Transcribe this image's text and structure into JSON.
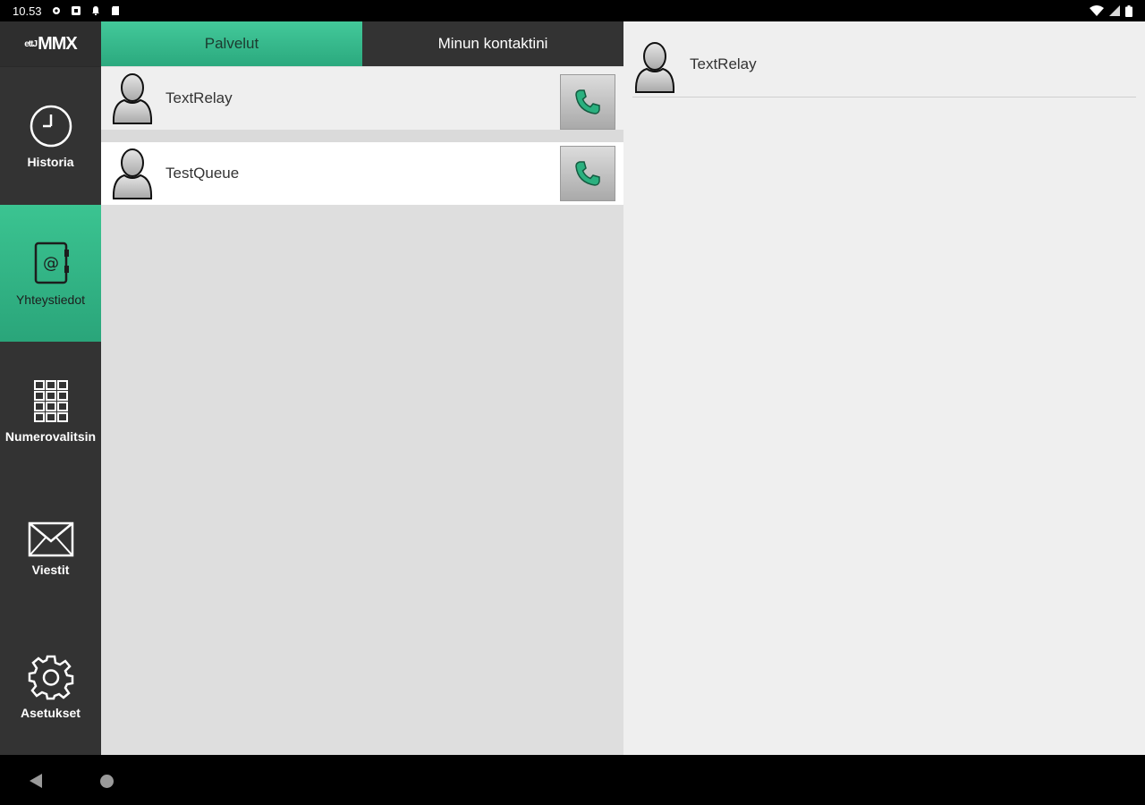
{
  "statusbar": {
    "time": "10.53"
  },
  "app": {
    "logo_prefix": "ettJ",
    "logo_main": "MMX"
  },
  "sidebar": {
    "items": [
      {
        "label": "Historia",
        "icon": "clock-icon",
        "active": false
      },
      {
        "label": "Yhteystiedot",
        "icon": "address-book-icon",
        "active": true
      },
      {
        "label": "Numerovalitsin",
        "icon": "dialpad-icon",
        "active": false
      },
      {
        "label": "Viestit",
        "icon": "envelope-icon",
        "active": false
      },
      {
        "label": "Asetukset",
        "icon": "gear-icon",
        "active": false
      }
    ]
  },
  "tabs": [
    {
      "label": "Palvelut",
      "active": true
    },
    {
      "label": "Minun kontaktini",
      "active": false
    }
  ],
  "contacts": [
    {
      "name": "TextRelay",
      "selected": true
    },
    {
      "name": "TestQueue",
      "selected": false
    }
  ],
  "detail": {
    "name": "TextRelay"
  },
  "colors": {
    "accent": "#33b98a",
    "sidebar": "#333333",
    "list_bg": "#dedede",
    "detail_bg": "#efefef"
  }
}
